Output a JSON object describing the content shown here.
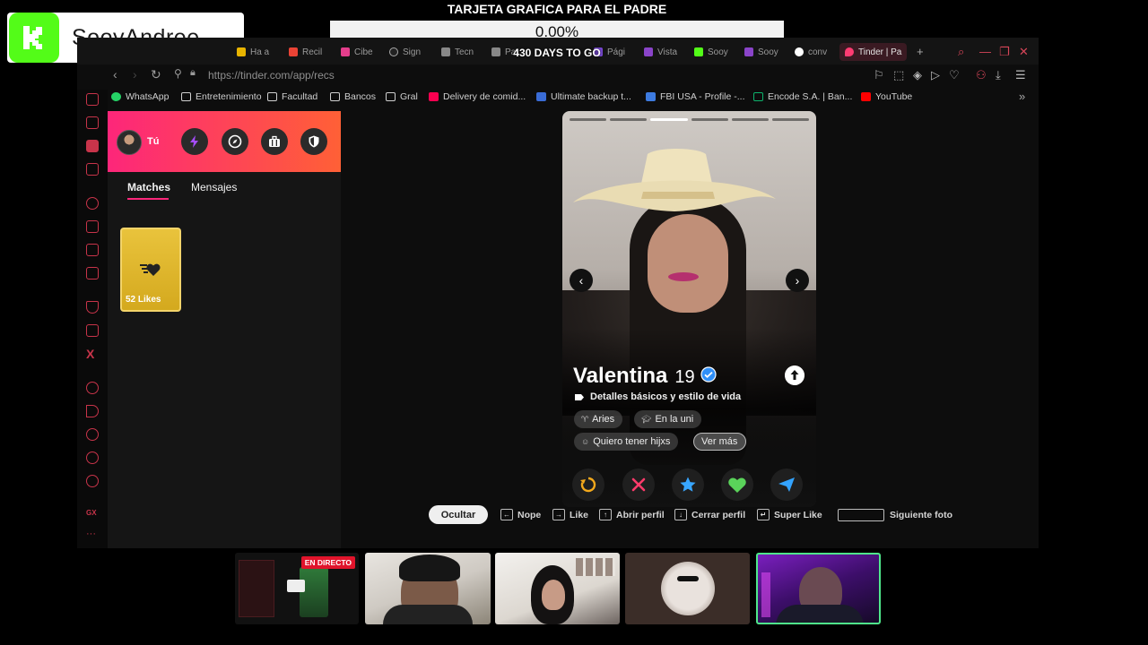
{
  "overlay": {
    "streamer_name": "SooyAndree",
    "goal_title": "TARJETA GRAFICA PARA EL PADRE",
    "goal_progress": "0.00%",
    "goal_progress_fraction": 0.0,
    "goal_days": "430 DAYS TO GO",
    "accent_color": "#53fc18"
  },
  "browser": {
    "tabs": [
      {
        "label": "Ha a",
        "icon": "tab-icon"
      },
      {
        "label": "Recil",
        "icon": "gmail-icon"
      },
      {
        "label": "Cibe",
        "icon": "tab-icon"
      },
      {
        "label": "Sign",
        "icon": "tab-icon"
      },
      {
        "label": "Tecn",
        "icon": "tab-icon"
      },
      {
        "label": "Pa",
        "icon": "tab-icon"
      },
      {
        "label": "Pági",
        "icon": "tab-icon"
      },
      {
        "label": "Vista",
        "icon": "tab-icon"
      },
      {
        "label": "Sooy",
        "icon": "kick-icon"
      },
      {
        "label": "Sooy",
        "icon": "tab-icon"
      },
      {
        "label": "conv",
        "icon": "google-icon"
      }
    ],
    "active_tab": {
      "label": "Tinder | Pa",
      "icon": "tinder-icon"
    },
    "url": "https://tinder.com/app/recs",
    "bookmarks": [
      {
        "label": "WhatsApp",
        "icon": "whatsapp-icon",
        "color": "#25d366"
      },
      {
        "label": "Entretenimiento",
        "icon": "folder-icon",
        "color": "#cfcfcf"
      },
      {
        "label": "Facultad",
        "icon": "folder-icon",
        "color": "#cfcfcf"
      },
      {
        "label": "Bancos",
        "icon": "folder-icon",
        "color": "#cfcfcf"
      },
      {
        "label": "Gral",
        "icon": "folder-icon",
        "color": "#cfcfcf"
      },
      {
        "label": "Delivery de comid...",
        "icon": "delivery-icon",
        "color": "#fa0050"
      },
      {
        "label": "Ultimate backup t...",
        "icon": "backup-icon",
        "color": "#3a6cd6"
      },
      {
        "label": "FBI USA - Profile -...",
        "icon": "fbi-icon",
        "color": "#3d7be0"
      },
      {
        "label": "Encode S.A. | Ban...",
        "icon": "encode-icon",
        "color": "#0db36c"
      },
      {
        "label": "YouTube",
        "icon": "youtube-icon",
        "color": "#ff0000"
      }
    ]
  },
  "tinder": {
    "user_label": "Tú",
    "tabs": [
      "Matches",
      "Mensajes"
    ],
    "likes_label": "52 Likes",
    "profile": {
      "name": "Valentina",
      "age": "19",
      "details_label": "Detalles básicos y estilo de vida",
      "chips": [
        "Aries",
        "En la uni",
        "Quiero tener hijxs",
        "Ver más"
      ],
      "photo_count": 6,
      "active_photo": 3
    },
    "actions": [
      "rewind-button",
      "nope-button",
      "super-like-button",
      "like-button",
      "boost-button"
    ]
  },
  "hints": {
    "hide_label": "Ocultar",
    "items": [
      {
        "key": "←",
        "label": "Nope"
      },
      {
        "key": "→",
        "label": "Like"
      },
      {
        "key": "↑",
        "label": "Abrir perfil"
      },
      {
        "key": "↓",
        "label": "Cerrar perfil"
      },
      {
        "key": "↵",
        "label": "Super Like"
      }
    ],
    "space_label": "Siguiente foto"
  },
  "cams": {
    "live_label": "EN DIRECTO"
  }
}
